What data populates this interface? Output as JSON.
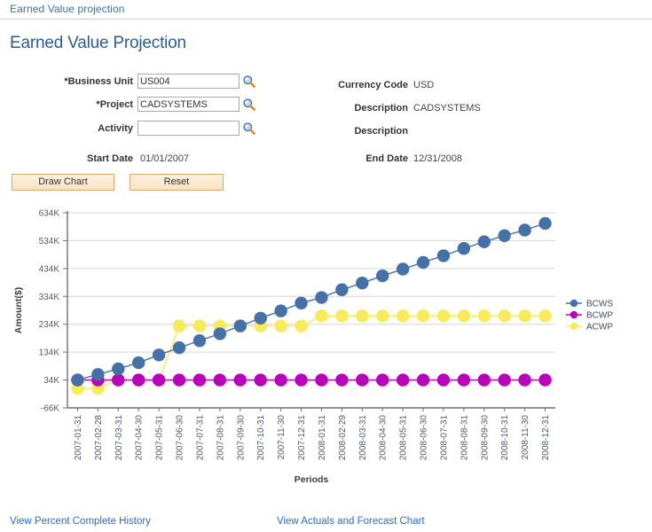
{
  "breadcrumb": {
    "label": "Earned Value projection"
  },
  "page": {
    "title": "Earned Value Projection"
  },
  "form": {
    "left": [
      {
        "label": "*Business Unit",
        "value": "US004",
        "placeholder": "",
        "icon": "lookup-search-icon"
      },
      {
        "label": "*Project",
        "value": "CADSYSTEMS",
        "placeholder": "",
        "icon": "lookup-search-icon"
      },
      {
        "label": "Activity",
        "value": "",
        "placeholder": "",
        "icon": "lookup-search-icon"
      }
    ],
    "start_date": {
      "label": "Start Date",
      "value": "01/01/2007"
    },
    "right": [
      {
        "label": "Currency Code",
        "value": "USD"
      },
      {
        "label": "Description",
        "value": "CADSYSTEMS"
      },
      {
        "label": "Description",
        "value": ""
      },
      {
        "label": "End Date",
        "value": "12/31/2008"
      }
    ]
  },
  "buttons": {
    "draw_chart": "Draw Chart",
    "reset": "Reset"
  },
  "links": {
    "view_percent_complete_history": "View Percent Complete History",
    "view_actuals_and_forecast_chart": "View Actuals and Forecast Chart"
  },
  "colors": {
    "bcws": "#4472a8",
    "bcwp": "#bb00bb",
    "acwp": "#f7eb5a",
    "axis": "#6b6f86",
    "grid": "#d6d6d6",
    "breadcrumb_link": "#3f6fad",
    "page_title": "#2b5c96",
    "button_face": "#f9e3c4",
    "button_border": "#d9a86c",
    "bottom_link": "#2f6bd0"
  },
  "chart_data": {
    "type": "line",
    "title": "",
    "xlabel": "Periods",
    "ylabel": "Amount($)",
    "ylim": [
      -66000,
      634000
    ],
    "yticks": [
      -66000,
      34000,
      134000,
      234000,
      334000,
      434000,
      534000,
      634000
    ],
    "ytick_labels": [
      "-66K",
      "34K",
      "134K",
      "234K",
      "334K",
      "434K",
      "534K",
      "634K"
    ],
    "grid": true,
    "legend_position": "right",
    "categories": [
      "2007-01-31",
      "2007-02-28",
      "2007-03-31",
      "2007-04-30",
      "2007-05-31",
      "2007-06-30",
      "2007-07-31",
      "2007-08-31",
      "2007-09-30",
      "2007-10-31",
      "2007-11-30",
      "2007-12-31",
      "2008-01-31",
      "2008-02-29",
      "2008-03-31",
      "2008-04-30",
      "2008-05-31",
      "2008-06-30",
      "2008-07-31",
      "2008-08-31",
      "2008-09-30",
      "2008-10-31",
      "2008-11-30",
      "2008-12-31"
    ],
    "series": [
      {
        "name": "BCWS",
        "color": "#4472a8",
        "values": [
          34000,
          54000,
          74000,
          96000,
          124000,
          150000,
          175000,
          200000,
          228000,
          256000,
          282000,
          310000,
          330000,
          358000,
          382000,
          408000,
          432000,
          456000,
          480000,
          506000,
          530000,
          552000,
          572000,
          596000
        ]
      },
      {
        "name": "BCWP",
        "color": "#bb00bb",
        "values": [
          34000,
          34000,
          34000,
          34000,
          34000,
          34000,
          34000,
          34000,
          34000,
          34000,
          34000,
          34000,
          34000,
          34000,
          34000,
          34000,
          34000,
          34000,
          34000,
          34000,
          34000,
          34000,
          34000,
          34000
        ]
      },
      {
        "name": "ACWP",
        "color": "#f7eb5a",
        "values": [
          4000,
          4000,
          34000,
          34000,
          34000,
          228000,
          228000,
          228000,
          228000,
          228000,
          228000,
          228000,
          264000,
          264000,
          264000,
          264000,
          264000,
          264000,
          264000,
          264000,
          264000,
          264000,
          264000,
          264000
        ]
      }
    ]
  }
}
